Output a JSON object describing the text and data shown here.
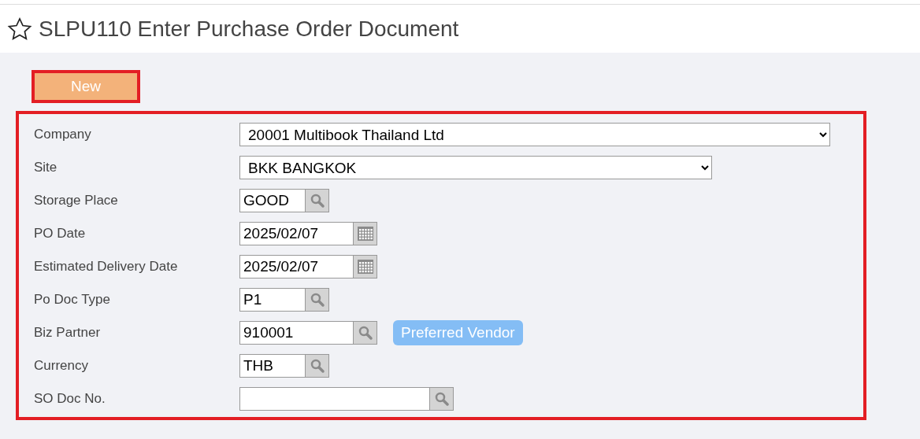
{
  "page": {
    "title": "SLPU110 Enter Purchase Order Document",
    "favorite": false
  },
  "new_button": {
    "label": "New",
    "highlighted": true
  },
  "form": {
    "highlighted": true,
    "fields": [
      {
        "label": "Company",
        "kind": "select",
        "value": "20001 Multibook Thailand Ltd"
      },
      {
        "label": "Site",
        "kind": "select",
        "value": "BKK BANGKOK"
      },
      {
        "label": "Storage Place",
        "kind": "lookup",
        "value": "GOOD"
      },
      {
        "label": "PO Date",
        "kind": "date",
        "value": "2025/02/07"
      },
      {
        "label": "Estimated Delivery Date",
        "kind": "date",
        "value": "2025/02/07"
      },
      {
        "label": "Po Doc Type",
        "kind": "lookup",
        "value": "P1"
      },
      {
        "label": "Biz Partner",
        "kind": "lookup",
        "value": "910001",
        "badge": "Preferred Vendor"
      },
      {
        "label": "Currency",
        "kind": "lookup",
        "value": "THB"
      },
      {
        "label": "SO Doc No.",
        "kind": "lookup"
      }
    ]
  }
}
